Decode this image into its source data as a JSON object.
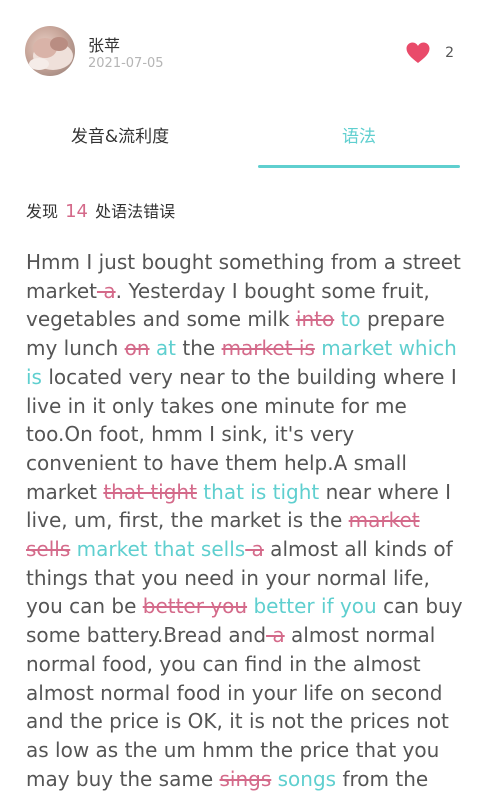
{
  "post": {
    "username": "张苹",
    "date": "2021-07-05",
    "like_count": "2"
  },
  "tabs": [
    {
      "label": "发音&流利度",
      "active": false
    },
    {
      "label": "语法",
      "active": true
    }
  ],
  "summary": {
    "prefix": "发现",
    "count": "14",
    "suffix": "处语法错误"
  },
  "colors": {
    "accent": "#5fcfcf",
    "error": "#d46a8a",
    "like": "#e94b6a"
  },
  "transcript": [
    {
      "t": "Hmm I just bought something from a street market"
    },
    {
      "t": " a",
      "kind": "del"
    },
    {
      "t": ". Yesterday I bought some fruit, vegetables and some milk "
    },
    {
      "t": "into",
      "kind": "del"
    },
    {
      "t": " "
    },
    {
      "t": "to",
      "kind": "ins"
    },
    {
      "t": " prepare my lunch "
    },
    {
      "t": "on",
      "kind": "del"
    },
    {
      "t": " "
    },
    {
      "t": "at",
      "kind": "ins"
    },
    {
      "t": " the "
    },
    {
      "t": "market is",
      "kind": "del"
    },
    {
      "t": " "
    },
    {
      "t": "market which is",
      "kind": "ins"
    },
    {
      "t": " located very near to the building where I live in it only takes one minute for me too.On foot, hmm I sink, it's very convenient to have them help.A small market "
    },
    {
      "t": "that tight",
      "kind": "del"
    },
    {
      "t": " "
    },
    {
      "t": "that is tight",
      "kind": "ins"
    },
    {
      "t": " near where I live, um, first, the market is the "
    },
    {
      "t": "market sells",
      "kind": "del"
    },
    {
      "t": " "
    },
    {
      "t": "market that sells",
      "kind": "ins"
    },
    {
      "t": " a",
      "kind": "del"
    },
    {
      "t": " almost all kinds of things that you need in your normal life, you can be "
    },
    {
      "t": "better you",
      "kind": "del"
    },
    {
      "t": " "
    },
    {
      "t": "better if you",
      "kind": "ins"
    },
    {
      "t": " can buy some battery.Bread and"
    },
    {
      "t": " a",
      "kind": "del"
    },
    {
      "t": " almost normal normal food, you can find in the almost almost normal food in your life on second and the price is OK, it is not the prices not as low as the um hmm the price that you may buy the same "
    },
    {
      "t": "sings",
      "kind": "del"
    },
    {
      "t": " "
    },
    {
      "t": "songs",
      "kind": "ins"
    },
    {
      "t": " from the"
    }
  ]
}
